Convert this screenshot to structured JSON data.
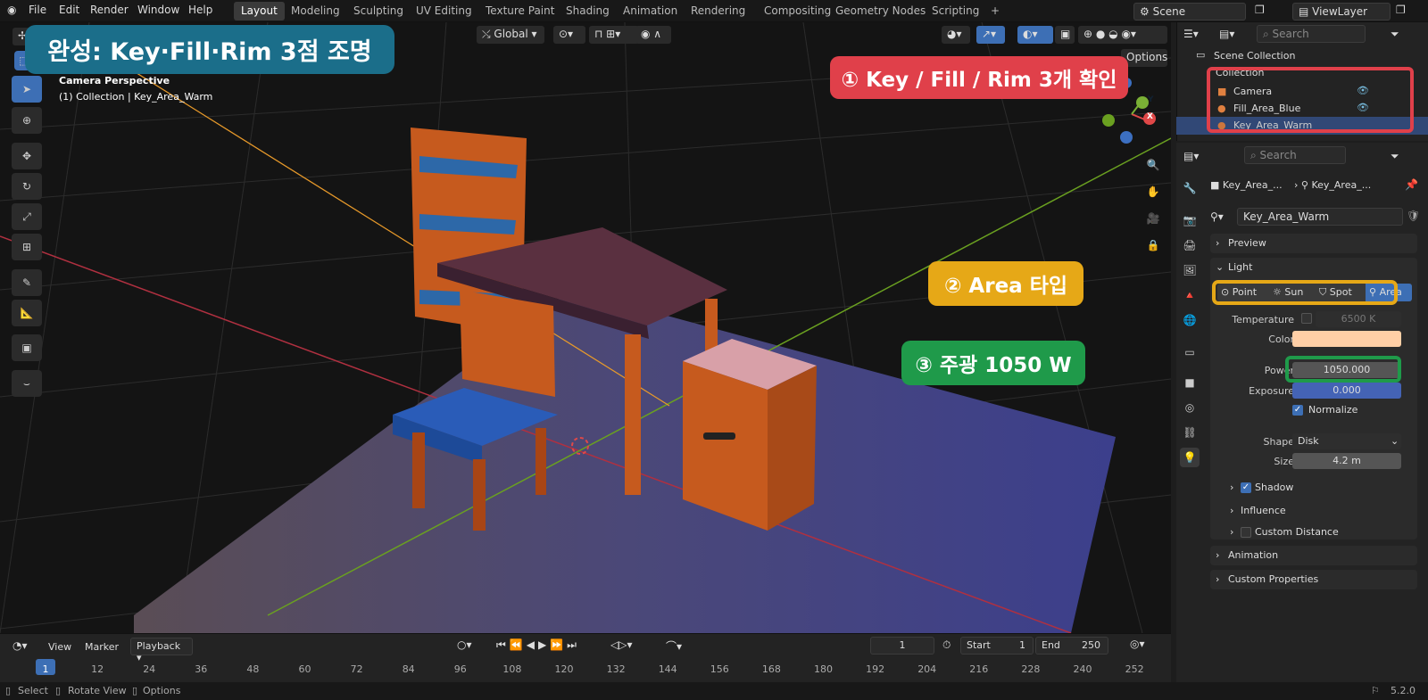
{
  "menus": [
    "File",
    "Edit",
    "Render",
    "Window",
    "Help"
  ],
  "workspaces": [
    "Layout",
    "Modeling",
    "Sculpting",
    "UV Editing",
    "Texture Paint",
    "Shading",
    "Animation",
    "Rendering",
    "Compositing",
    "Geometry Nodes",
    "Scripting",
    "+"
  ],
  "scene": {
    "label": "Scene",
    "view_layer": "ViewLayer"
  },
  "viewport": {
    "transform_orientation": "Global",
    "options": "Options",
    "camera_title": "Camera Perspective",
    "camera_sub": "(1) Collection | Key_Area_Warm",
    "gizmo_y": "Y",
    "gizmo_x": "X"
  },
  "annotations": {
    "title": "완성: Key·Fill·Rim 3점 조명",
    "step1": "① Key / Fill / Rim 3개 확인",
    "step2": "② Area 타입",
    "step3": "③ 주광 1050 W",
    "title_color": "#1b6e8a",
    "step1_color": "#e0404a",
    "step2_color": "#e6a817",
    "step3_color": "#1f9a4a"
  },
  "outliner": {
    "search_placeholder": "Search",
    "scene_collection": "Scene Collection",
    "collection": "Collection",
    "items": [
      "Camera",
      "Fill_Area_Blue",
      "Key_Area_Warm"
    ]
  },
  "properties": {
    "search_placeholder": "Search",
    "breadcrumb_obj": "Key_Area_...",
    "breadcrumb_data": "Key_Area_...",
    "datablock": "Key_Area_Warm",
    "preview": "Preview",
    "light": "Light",
    "light_types": [
      "Point",
      "Sun",
      "Spot",
      "Area"
    ],
    "temperature_label": "Temperature",
    "temperature_value": "6500 K",
    "color_label": "Color",
    "color_hex": "#ffcfa6",
    "power_label": "Power",
    "power_value": "1050.000",
    "exposure_label": "Exposure",
    "exposure_value": "0.000",
    "normalize": "Normalize",
    "shape_label": "Shape",
    "shape_value": "Disk",
    "size_label": "Size",
    "size_value": "4.2 m",
    "shadow": "Shadow",
    "influence": "Influence",
    "custom_distance": "Custom Distance",
    "animation": "Animation",
    "custom_properties": "Custom Properties"
  },
  "timeline": {
    "menus": [
      "View",
      "Marker",
      "Playback"
    ],
    "current_frame": "1",
    "start_label": "Start",
    "start_value": "1",
    "end_label": "End",
    "end_value": "250",
    "ticks": [
      "1",
      "12",
      "24",
      "36",
      "48",
      "60",
      "72",
      "84",
      "96",
      "108",
      "120",
      "132",
      "144",
      "156",
      "168",
      "180",
      "192",
      "204",
      "216",
      "228",
      "240",
      "252"
    ]
  },
  "statusbar": {
    "select": "Select",
    "rotate": "Rotate View",
    "options": "Options",
    "version": "5.2.0"
  }
}
